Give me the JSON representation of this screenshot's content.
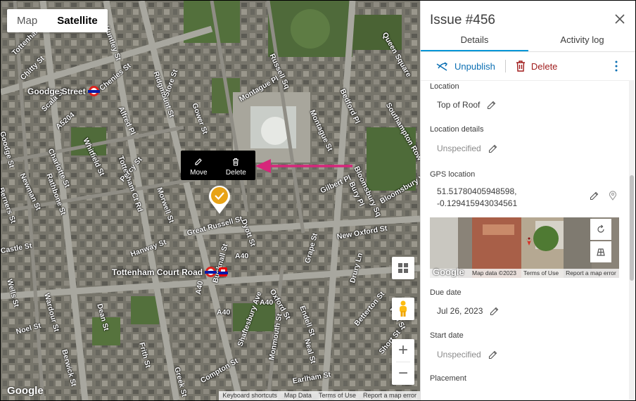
{
  "map": {
    "map_type_tabs": [
      "Map",
      "Satellite"
    ],
    "active_map_type": "Satellite",
    "streets": [
      "Tottenham Ct Rd",
      "Huntley St",
      "Chenies St",
      "Ridgmount St",
      "Store St",
      "Gower St",
      "Alfred Pl",
      "Montague Pl",
      "Russell Sq",
      "Bedford Pl",
      "Montague St",
      "Southampton Row",
      "Queen Square",
      "Charlotte St",
      "Whitfield St",
      "Scala St",
      "Goodge St",
      "A5204",
      "Chitty St",
      "Tottenham Ct Rd",
      "Percy St",
      "Morwell St",
      "Rathbone St",
      "Newman St",
      "Berners St",
      "Great Russell St",
      "Dyott St",
      "New Oxford St",
      "Gilbert Pl",
      "Bury Pl",
      "Hanway St",
      "A40",
      "A40",
      "A40",
      "A40",
      "Oxford St",
      "Grape St",
      "Drury Ln",
      "Endell St",
      "Wardour St",
      "Dean St",
      "Frith St",
      "Greek St",
      "Shaftesbury Ave",
      "Monmouth St",
      "Neal St",
      "Earlham St",
      "Noel St",
      "Berwick St",
      "Wells St",
      "Castle St",
      "Compton St",
      "Bloomsbury Sq",
      "Bloomsbury Way",
      "Betterton St",
      "Short St",
      "Wild St",
      "Bucknall St"
    ],
    "stations": {
      "goodge": "Goodge Street",
      "tcr": "Tottenham Court Road"
    },
    "context_menu": {
      "move": "Move",
      "delete": "Delete"
    },
    "google_logo": "Google",
    "attribution": [
      "Keyboard shortcuts",
      "Map Data",
      "Terms of Use",
      "Report a map error"
    ],
    "pin_color": "#e8a317",
    "arrow_color": "#d6277b"
  },
  "panel": {
    "title": "Issue #456",
    "tabs": [
      "Details",
      "Activity log"
    ],
    "active_tab": "Details",
    "unpublish": "Unpublish",
    "delete": "Delete",
    "fields": {
      "location_label": "Location",
      "location_value": "Top of Roof",
      "location_details_label": "Location details",
      "location_details_value": "Unspecified",
      "gps_label": "GPS location",
      "gps_lat": "51.51780405948598,",
      "gps_lng": "-0.129415943034561",
      "due_label": "Due date",
      "due_value": "Jul 26, 2023",
      "start_label": "Start date",
      "start_value": "Unspecified",
      "placement_label": "Placement"
    },
    "minimap": {
      "google": "Google",
      "attribution": [
        "Map data ©2023",
        "Terms of Use",
        "Report a map error"
      ]
    },
    "accent_color": "#0696d7",
    "danger_color": "#a01c1c"
  }
}
